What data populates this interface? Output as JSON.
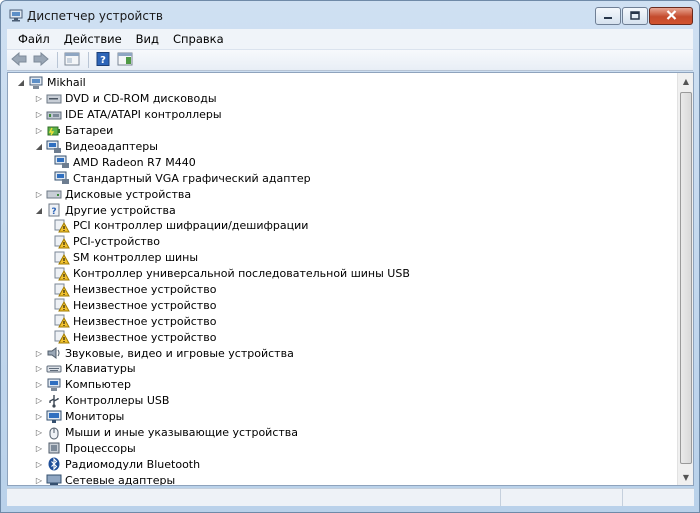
{
  "window": {
    "title": "Диспетчер устройств",
    "icon": "device-manager-icon"
  },
  "caption_buttons": [
    "minimize-icon",
    "maximize-icon",
    "close-icon"
  ],
  "menu": [
    "Файл",
    "Действие",
    "Вид",
    "Справка"
  ],
  "toolbar": [
    "back-icon",
    "forward-icon",
    "properties-icon",
    "help-icon",
    "console-icon"
  ],
  "tree": {
    "root": {
      "label": "Mikhail",
      "icon": "computer-icon",
      "expanded": true
    },
    "categories": [
      {
        "label": "DVD и CD-ROM дисководы",
        "icon": "dvd-drive-icon",
        "expanded": false
      },
      {
        "label": "IDE ATA/ATAPI контроллеры",
        "icon": "ide-controller-icon",
        "expanded": false
      },
      {
        "label": "Батареи",
        "icon": "battery-icon",
        "expanded": false
      },
      {
        "label": "Видеоадаптеры",
        "icon": "display-adapter-icon",
        "expanded": true,
        "children": [
          {
            "label": "AMD Radeon R7 M440",
            "icon": "display-adapter-icon"
          },
          {
            "label": "Стандартный VGA графический адаптер",
            "icon": "display-adapter-icon"
          }
        ]
      },
      {
        "label": "Дисковые устройства",
        "icon": "disk-drive-icon",
        "expanded": false
      },
      {
        "label": "Другие устройства",
        "icon": "other-devices-icon",
        "expanded": true,
        "children": [
          {
            "label": "PCI контроллер шифрации/дешифрации",
            "icon": "warning-device-icon"
          },
          {
            "label": "PCI-устройство",
            "icon": "warning-device-icon"
          },
          {
            "label": "SM контроллер шины",
            "icon": "warning-device-icon"
          },
          {
            "label": "Контроллер универсальной последовательной шины USB",
            "icon": "warning-device-icon"
          },
          {
            "label": "Неизвестное устройство",
            "icon": "warning-device-icon"
          },
          {
            "label": "Неизвестное устройство",
            "icon": "warning-device-icon"
          },
          {
            "label": "Неизвестное устройство",
            "icon": "warning-device-icon"
          },
          {
            "label": "Неизвестное устройство",
            "icon": "warning-device-icon"
          }
        ]
      },
      {
        "label": "Звуковые, видео и игровые устройства",
        "icon": "speaker-icon",
        "expanded": false
      },
      {
        "label": "Клавиатуры",
        "icon": "keyboard-icon",
        "expanded": false
      },
      {
        "label": "Компьютер",
        "icon": "computer-icon",
        "expanded": false
      },
      {
        "label": "Контроллеры USB",
        "icon": "usb-icon",
        "expanded": false
      },
      {
        "label": "Мониторы",
        "icon": "monitor-icon",
        "expanded": false
      },
      {
        "label": "Мыши и иные указывающие устройства",
        "icon": "mouse-icon",
        "expanded": false
      },
      {
        "label": "Процессоры",
        "icon": "processor-icon",
        "expanded": false
      },
      {
        "label": "Радиомодули Bluetooth",
        "icon": "bluetooth-icon",
        "expanded": false
      },
      {
        "label": "Сетевые адаптеры",
        "icon": "network-adapter-icon",
        "expanded": false
      }
    ]
  },
  "colors": {
    "title_bar": "#b9d1ea",
    "close_button": "#c44b2d",
    "warning": "#f2c230"
  }
}
